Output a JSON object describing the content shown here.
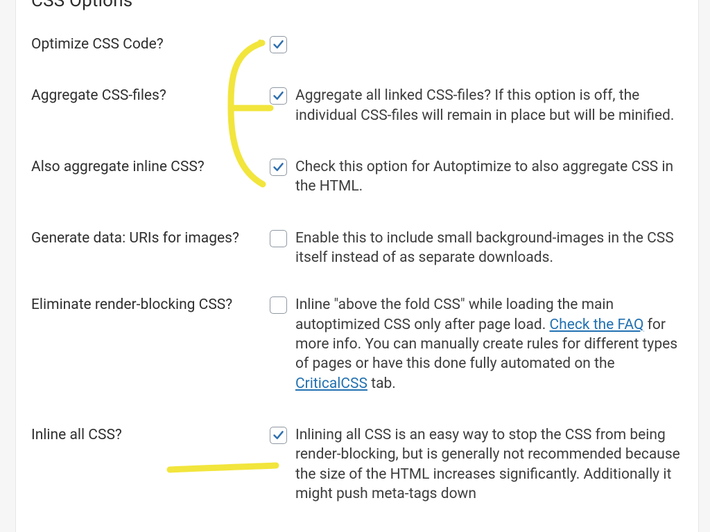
{
  "section_title": "CSS Options",
  "rows": {
    "optimize": {
      "label": "Optimize CSS Code?",
      "checked": true,
      "desc": ""
    },
    "aggregate": {
      "label": "Aggregate CSS-files?",
      "checked": true,
      "desc": "Aggregate all linked CSS-files? If this option is off, the individual CSS-files will remain in place but will be minified."
    },
    "inline_agg": {
      "label": "Also aggregate inline CSS?",
      "checked": true,
      "desc": "Check this option for Autoptimize to also aggregate CSS in the HTML."
    },
    "data_uris": {
      "label": "Generate data: URIs for images?",
      "checked": false,
      "desc": "Enable this to include small background-images in the CSS itself instead of as separate downloads."
    },
    "render_block": {
      "label": "Eliminate render-blocking CSS?",
      "checked": false,
      "desc_before": "Inline \"above the fold CSS\" while loading the main autoptimized CSS only after page load. ",
      "link1_text": "Check the FAQ",
      "desc_mid": " for more info. You can manually create rules for different types of pages or have this done fully automated on the ",
      "link2_text": "CriticalCSS",
      "desc_after": " tab."
    },
    "inline_all": {
      "label": "Inline all CSS?",
      "checked": true,
      "desc": "Inlining all CSS is an easy way to stop the CSS from being render-blocking, but is generally not recommended because the size of the HTML increases significantly. Additionally it might push meta-tags down"
    }
  },
  "colors": {
    "check": "#2f6fb0",
    "annotation": "#f2e53c"
  }
}
